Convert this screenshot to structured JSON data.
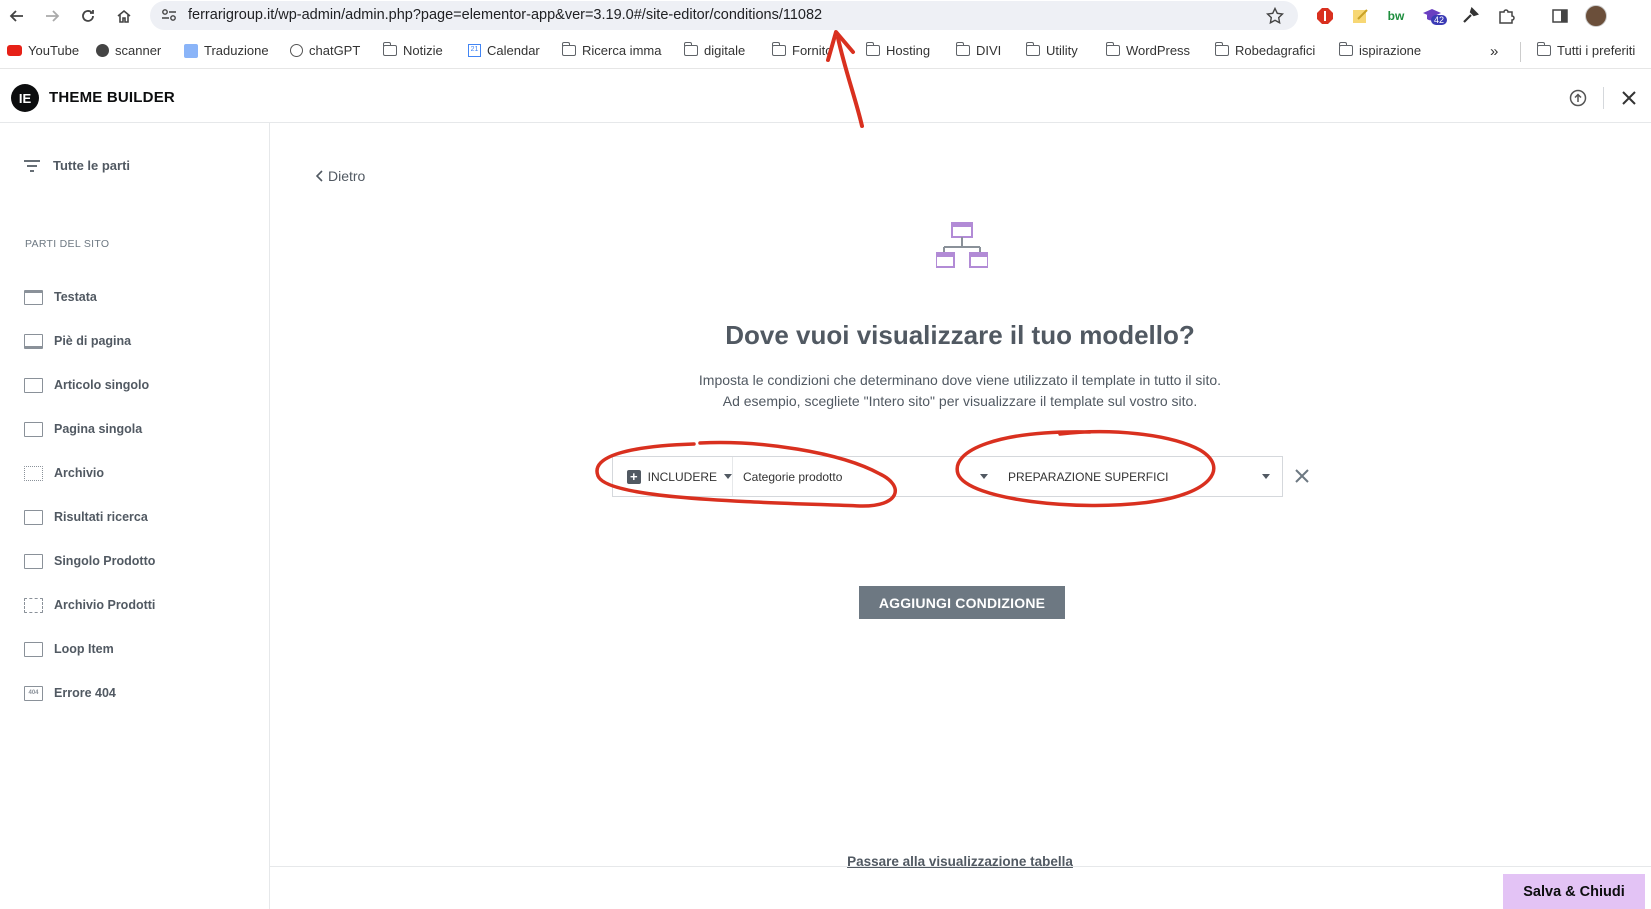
{
  "browser": {
    "url": "ferrarigroup.it/wp-admin/admin.php?page=elementor-app&ver=3.19.0#/site-editor/conditions/11082",
    "extension_badge": "42",
    "bookmarks": [
      "YouTube",
      "scanner",
      "Traduzione",
      "chatGPT",
      "Notizie",
      "Calendar",
      "Ricerca imma",
      "digitale",
      "Fornito",
      "Hosting",
      "DIVI",
      "Utility",
      "WordPress",
      "Robedagrafici",
      "ispirazione"
    ],
    "bookmarks_overflow": "»",
    "all_bookmarks": "Tutti i preferiti"
  },
  "app": {
    "logo": "IE",
    "title": "THEME BUILDER"
  },
  "sidebar": {
    "all_parts": "Tutte le parti",
    "section_title": "PARTI DEL SITO",
    "items": [
      "Testata",
      "Piè di pagina",
      "Articolo singolo",
      "Pagina singola",
      "Archivio",
      "Risultati ricerca",
      "Singolo Prodotto",
      "Archivio Prodotti",
      "Loop Item",
      "Errore 404"
    ]
  },
  "main": {
    "back": "Dietro",
    "heading": "Dove vuoi visualizzare il tuo modello?",
    "desc_line1": "Imposta le condizioni che determinano dove viene utilizzato il template in tutto il sito.",
    "desc_line2": "Ad esempio, scegliete \"Intero sito\" per visualizzare il template sul vostro sito.",
    "condition": {
      "include": "INCLUDERE",
      "category": "Categorie prodotto",
      "term": "PREPARAZIONE SUPERFICI"
    },
    "add_condition": "AGGIUNGI CONDIZIONE",
    "table_view": "Passare alla visualizzazione tabella",
    "save_close": "Salva & Chiudi"
  },
  "colors": {
    "annotation": "#d9301f",
    "accent_save": "#e3c3f5",
    "hero_icon": "#b28bd6"
  }
}
